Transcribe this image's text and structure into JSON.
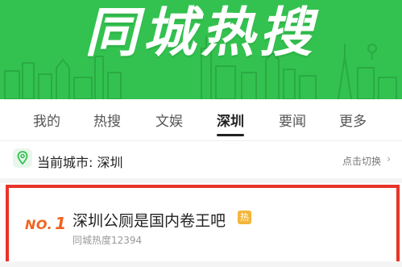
{
  "banner": {
    "title": "同城热搜",
    "background_color": "#33c24f"
  },
  "tabs": [
    {
      "label": "我的",
      "active": false
    },
    {
      "label": "热搜",
      "active": false
    },
    {
      "label": "文娱",
      "active": false
    },
    {
      "label": "深圳",
      "active": true
    },
    {
      "label": "要闻",
      "active": false
    },
    {
      "label": "更多",
      "active": false
    }
  ],
  "city": {
    "icon": "location-pin-icon",
    "label": "当前城市: 深圳",
    "switch_label": "点击切换",
    "switch_arrow": "›"
  },
  "hot_list": [
    {
      "rank_prefix": "NO.",
      "rank": "1",
      "title": "深圳公厕是国内卷王吧",
      "badge": "热",
      "heat": "同城热度12394"
    }
  ],
  "colors": {
    "accent_green": "#33c24f",
    "highlight_border": "#e8342a",
    "rank_orange": "#f0631f",
    "hot_badge": "#f3b53a"
  }
}
